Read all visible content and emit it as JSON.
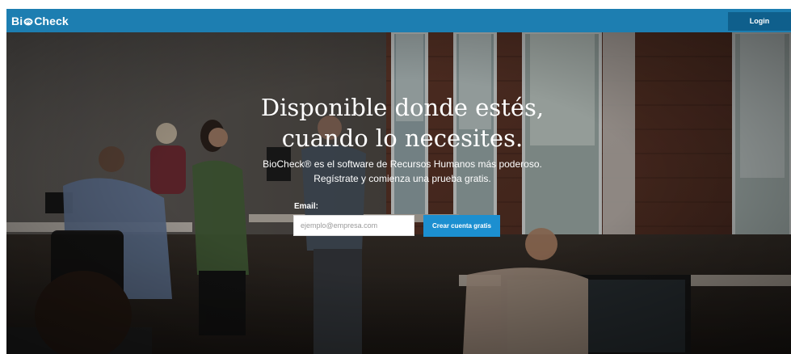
{
  "navbar": {
    "logo": {
      "before": "Bi",
      "after": "Check"
    },
    "login_label": "Login"
  },
  "hero": {
    "title_line1": "Disponible donde estés,",
    "title_line2": "cuando lo necesites.",
    "subtitle_line1": "BioCheck® es el software de Recursos Humanos más poderoso.",
    "subtitle_line2": "Regístrate y comienza una prueba gratis.",
    "email_label": "Email:",
    "email_placeholder": "ejemplo@empresa.com",
    "email_value": "",
    "cta_label": "Crear cuenta gratis"
  },
  "colors": {
    "navbar": "#1d7eb1",
    "login_button": "#0f5f8c",
    "cta_button": "#1c8fd0",
    "hero_text": "#ffffff"
  },
  "icons": {
    "logo_mark": "fingerprint-icon"
  }
}
